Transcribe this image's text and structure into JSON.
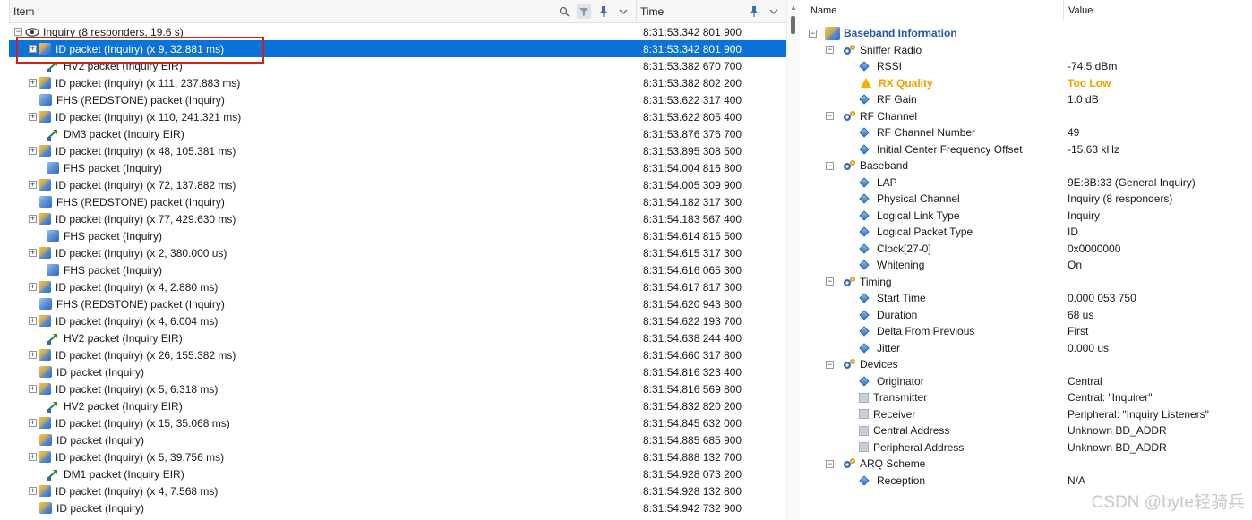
{
  "left": {
    "headers": {
      "item": "Item",
      "time": "Time"
    },
    "rows": [
      {
        "label": "Inquiry (8 responders, 19.6 s)",
        "time": "8:31:53.342 801 900",
        "kind": "root"
      },
      {
        "label": "ID packet (Inquiry) (x 9, 32.881 ms)",
        "time": "8:31:53.342 801 900",
        "kind": "group",
        "selected": true
      },
      {
        "label": "HV2 packet (Inquiry EIR)",
        "time": "8:31:53.382 670 700",
        "kind": "green"
      },
      {
        "label": "ID packet (Inquiry) (x 111, 237.883 ms)",
        "time": "8:31:53.382 802 200",
        "kind": "group"
      },
      {
        "label": "FHS (REDSTONE) packet (Inquiry)",
        "time": "8:31:53.622 317 400",
        "kind": "blue"
      },
      {
        "label": "ID packet (Inquiry) (x 110, 241.321 ms)",
        "time": "8:31:53.622 805 400",
        "kind": "group"
      },
      {
        "label": "DM3 packet (Inquiry EIR)",
        "time": "8:31:53.876 376 700",
        "kind": "green"
      },
      {
        "label": "ID packet (Inquiry) (x 48, 105.381 ms)",
        "time": "8:31:53.895 308 500",
        "kind": "group"
      },
      {
        "label": "FHS packet (Inquiry)",
        "time": "8:31:54.004 816 800",
        "kind": "blue2"
      },
      {
        "label": "ID packet (Inquiry) (x 72, 137.882 ms)",
        "time": "8:31:54.005 309 900",
        "kind": "group"
      },
      {
        "label": "FHS (REDSTONE) packet (Inquiry)",
        "time": "8:31:54.182 317 300",
        "kind": "blue"
      },
      {
        "label": "ID packet (Inquiry) (x 77, 429.630 ms)",
        "time": "8:31:54.183 567 400",
        "kind": "group"
      },
      {
        "label": "FHS packet (Inquiry)",
        "time": "8:31:54.614 815 500",
        "kind": "blue2"
      },
      {
        "label": "ID packet (Inquiry) (x 2, 380.000 us)",
        "time": "8:31:54.615 317 300",
        "kind": "group"
      },
      {
        "label": "FHS packet (Inquiry)",
        "time": "8:31:54.616 065 300",
        "kind": "blue2"
      },
      {
        "label": "ID packet (Inquiry) (x 4, 2.880 ms)",
        "time": "8:31:54.617 817 300",
        "kind": "group"
      },
      {
        "label": "FHS (REDSTONE) packet (Inquiry)",
        "time": "8:31:54.620 943 800",
        "kind": "blue"
      },
      {
        "label": "ID packet (Inquiry) (x 4, 6.004 ms)",
        "time": "8:31:54.622 193 700",
        "kind": "group"
      },
      {
        "label": "HV2 packet (Inquiry EIR)",
        "time": "8:31:54.638 244 400",
        "kind": "green"
      },
      {
        "label": "ID packet (Inquiry) (x 26, 155.382 ms)",
        "time": "8:31:54.660 317 800",
        "kind": "group"
      },
      {
        "label": "ID packet (Inquiry)",
        "time": "8:31:54.816 323 400",
        "kind": "single"
      },
      {
        "label": "ID packet (Inquiry) (x 5, 6.318 ms)",
        "time": "8:31:54.816 569 800",
        "kind": "group"
      },
      {
        "label": "HV2 packet (Inquiry EIR)",
        "time": "8:31:54.832 820 200",
        "kind": "green"
      },
      {
        "label": "ID packet (Inquiry) (x 15, 35.068 ms)",
        "time": "8:31:54.845 632 000",
        "kind": "group"
      },
      {
        "label": "ID packet (Inquiry)",
        "time": "8:31:54.885 685 900",
        "kind": "single"
      },
      {
        "label": "ID packet (Inquiry) (x 5, 39.756 ms)",
        "time": "8:31:54.888 132 700",
        "kind": "group"
      },
      {
        "label": "DM1 packet (Inquiry EIR)",
        "time": "8:31:54.928 073 200",
        "kind": "green"
      },
      {
        "label": "ID packet (Inquiry) (x 4, 7.568 ms)",
        "time": "8:31:54.928 132 800",
        "kind": "group"
      },
      {
        "label": "ID packet (Inquiry)",
        "time": "8:31:54.942 732 900",
        "kind": "single"
      }
    ]
  },
  "right": {
    "headers": {
      "name": "Name",
      "value": "Value"
    },
    "rows": [
      {
        "name": "Baseband Information",
        "value": "",
        "level": 0,
        "kind": "root"
      },
      {
        "name": "Sniffer Radio",
        "value": "",
        "level": 1,
        "kind": "section"
      },
      {
        "name": "RSSI",
        "value": "-74.5 dBm",
        "level": 2,
        "kind": "prop"
      },
      {
        "name": "RX Quality",
        "value": "Too Low",
        "level": 2,
        "kind": "warn"
      },
      {
        "name": "RF Gain",
        "value": "1.0 dB",
        "level": 2,
        "kind": "prop"
      },
      {
        "name": "RF Channel",
        "value": "",
        "level": 1,
        "kind": "section"
      },
      {
        "name": "RF Channel Number",
        "value": "49",
        "level": 2,
        "kind": "prop"
      },
      {
        "name": "Initial Center Frequency Offset",
        "value": "-15.63 kHz",
        "level": 2,
        "kind": "prop"
      },
      {
        "name": "Baseband",
        "value": "",
        "level": 1,
        "kind": "section"
      },
      {
        "name": "LAP",
        "value": "9E:8B:33 (General Inquiry)",
        "level": 2,
        "kind": "prop"
      },
      {
        "name": "Physical Channel",
        "value": "Inquiry (8 responders)",
        "level": 2,
        "kind": "prop"
      },
      {
        "name": "Logical Link Type",
        "value": "Inquiry",
        "level": 2,
        "kind": "prop"
      },
      {
        "name": "Logical Packet Type",
        "value": "ID",
        "level": 2,
        "kind": "prop"
      },
      {
        "name": "Clock[27-0]",
        "value": "0x0000000",
        "level": 2,
        "kind": "prop"
      },
      {
        "name": "Whitening",
        "value": "On",
        "level": 2,
        "kind": "prop"
      },
      {
        "name": "Timing",
        "value": "",
        "level": 1,
        "kind": "section"
      },
      {
        "name": "Start Time",
        "value": "0.000 053 750",
        "level": 2,
        "kind": "prop"
      },
      {
        "name": "Duration",
        "value": "68 us",
        "level": 2,
        "kind": "prop"
      },
      {
        "name": "Delta From Previous",
        "value": "First",
        "level": 2,
        "kind": "prop"
      },
      {
        "name": "Jitter",
        "value": "0.000 us",
        "level": 2,
        "kind": "prop"
      },
      {
        "name": "Devices",
        "value": "",
        "level": 1,
        "kind": "section"
      },
      {
        "name": "Originator",
        "value": "Central",
        "level": 2,
        "kind": "prop"
      },
      {
        "name": "Transmitter",
        "value": "Central: \"Inquirer\"",
        "level": 2,
        "kind": "square"
      },
      {
        "name": "Receiver",
        "value": "Peripheral: \"Inquiry Listeners\"",
        "level": 2,
        "kind": "square"
      },
      {
        "name": "Central Address",
        "value": "Unknown BD_ADDR",
        "level": 2,
        "kind": "square"
      },
      {
        "name": "Peripheral Address",
        "value": "Unknown BD_ADDR",
        "level": 2,
        "kind": "square"
      },
      {
        "name": "ARQ Scheme",
        "value": "",
        "level": 1,
        "kind": "section"
      },
      {
        "name": "Reception",
        "value": "N/A",
        "level": 2,
        "kind": "prop"
      }
    ]
  },
  "watermark": "CSDN @byte轻骑兵",
  "colors": {
    "selection": "#0a72d8",
    "highlight": "#d22020",
    "warning": "#f2a200",
    "section_title": "#2356a8"
  }
}
